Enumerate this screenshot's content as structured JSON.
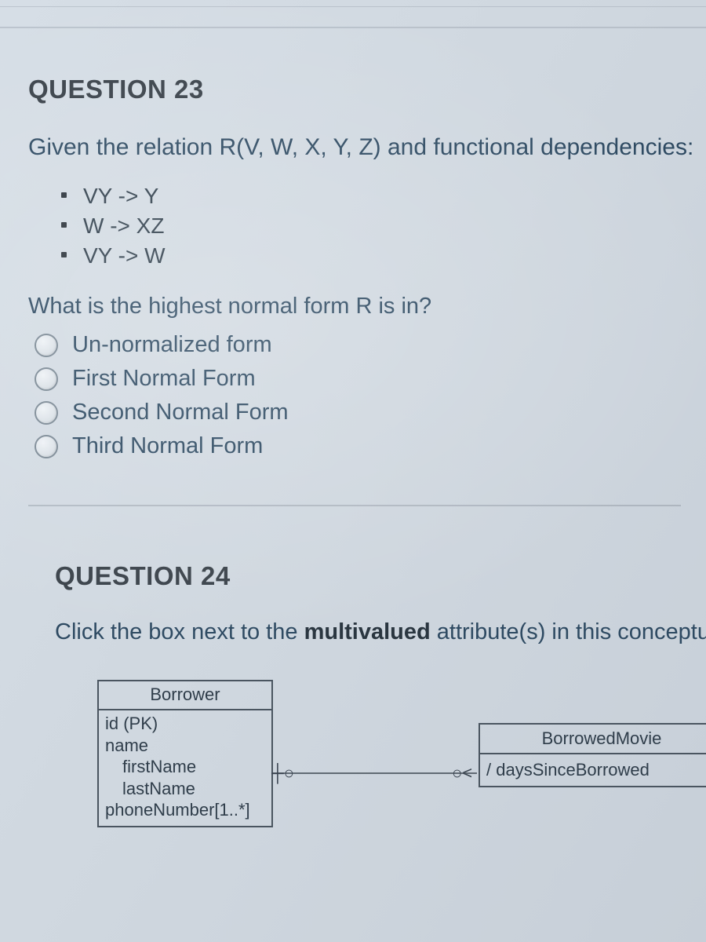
{
  "q23": {
    "title": "QUESTION 23",
    "prompt": "Given the relation R(V, W, X, Y, Z) and functional dependencies:",
    "fds": [
      "VY -> Y",
      "W -> XZ",
      "VY -> W"
    ],
    "sub": "What is the highest normal form R is in?",
    "options": [
      "Un-normalized form",
      "First Normal Form",
      "Second Normal Form",
      "Third Normal Form"
    ]
  },
  "q24": {
    "title": "QUESTION 24",
    "prompt_pre": "Click the box next to the ",
    "prompt_bold": "multivalued",
    "prompt_post": " attribute(s) in this conceptua",
    "borrower": {
      "name": "Borrower",
      "attrs": {
        "a0": "id (PK)",
        "a1": "name",
        "a1a": "firstName",
        "a1b": "lastName",
        "a2": "phoneNumber[1..*]"
      }
    },
    "bmovie": {
      "name": "BorrowedMovie",
      "attr": "daysSinceBorrowed"
    },
    "markers": {
      "left": "┼○",
      "right": "○<",
      "slash": "/ "
    }
  }
}
